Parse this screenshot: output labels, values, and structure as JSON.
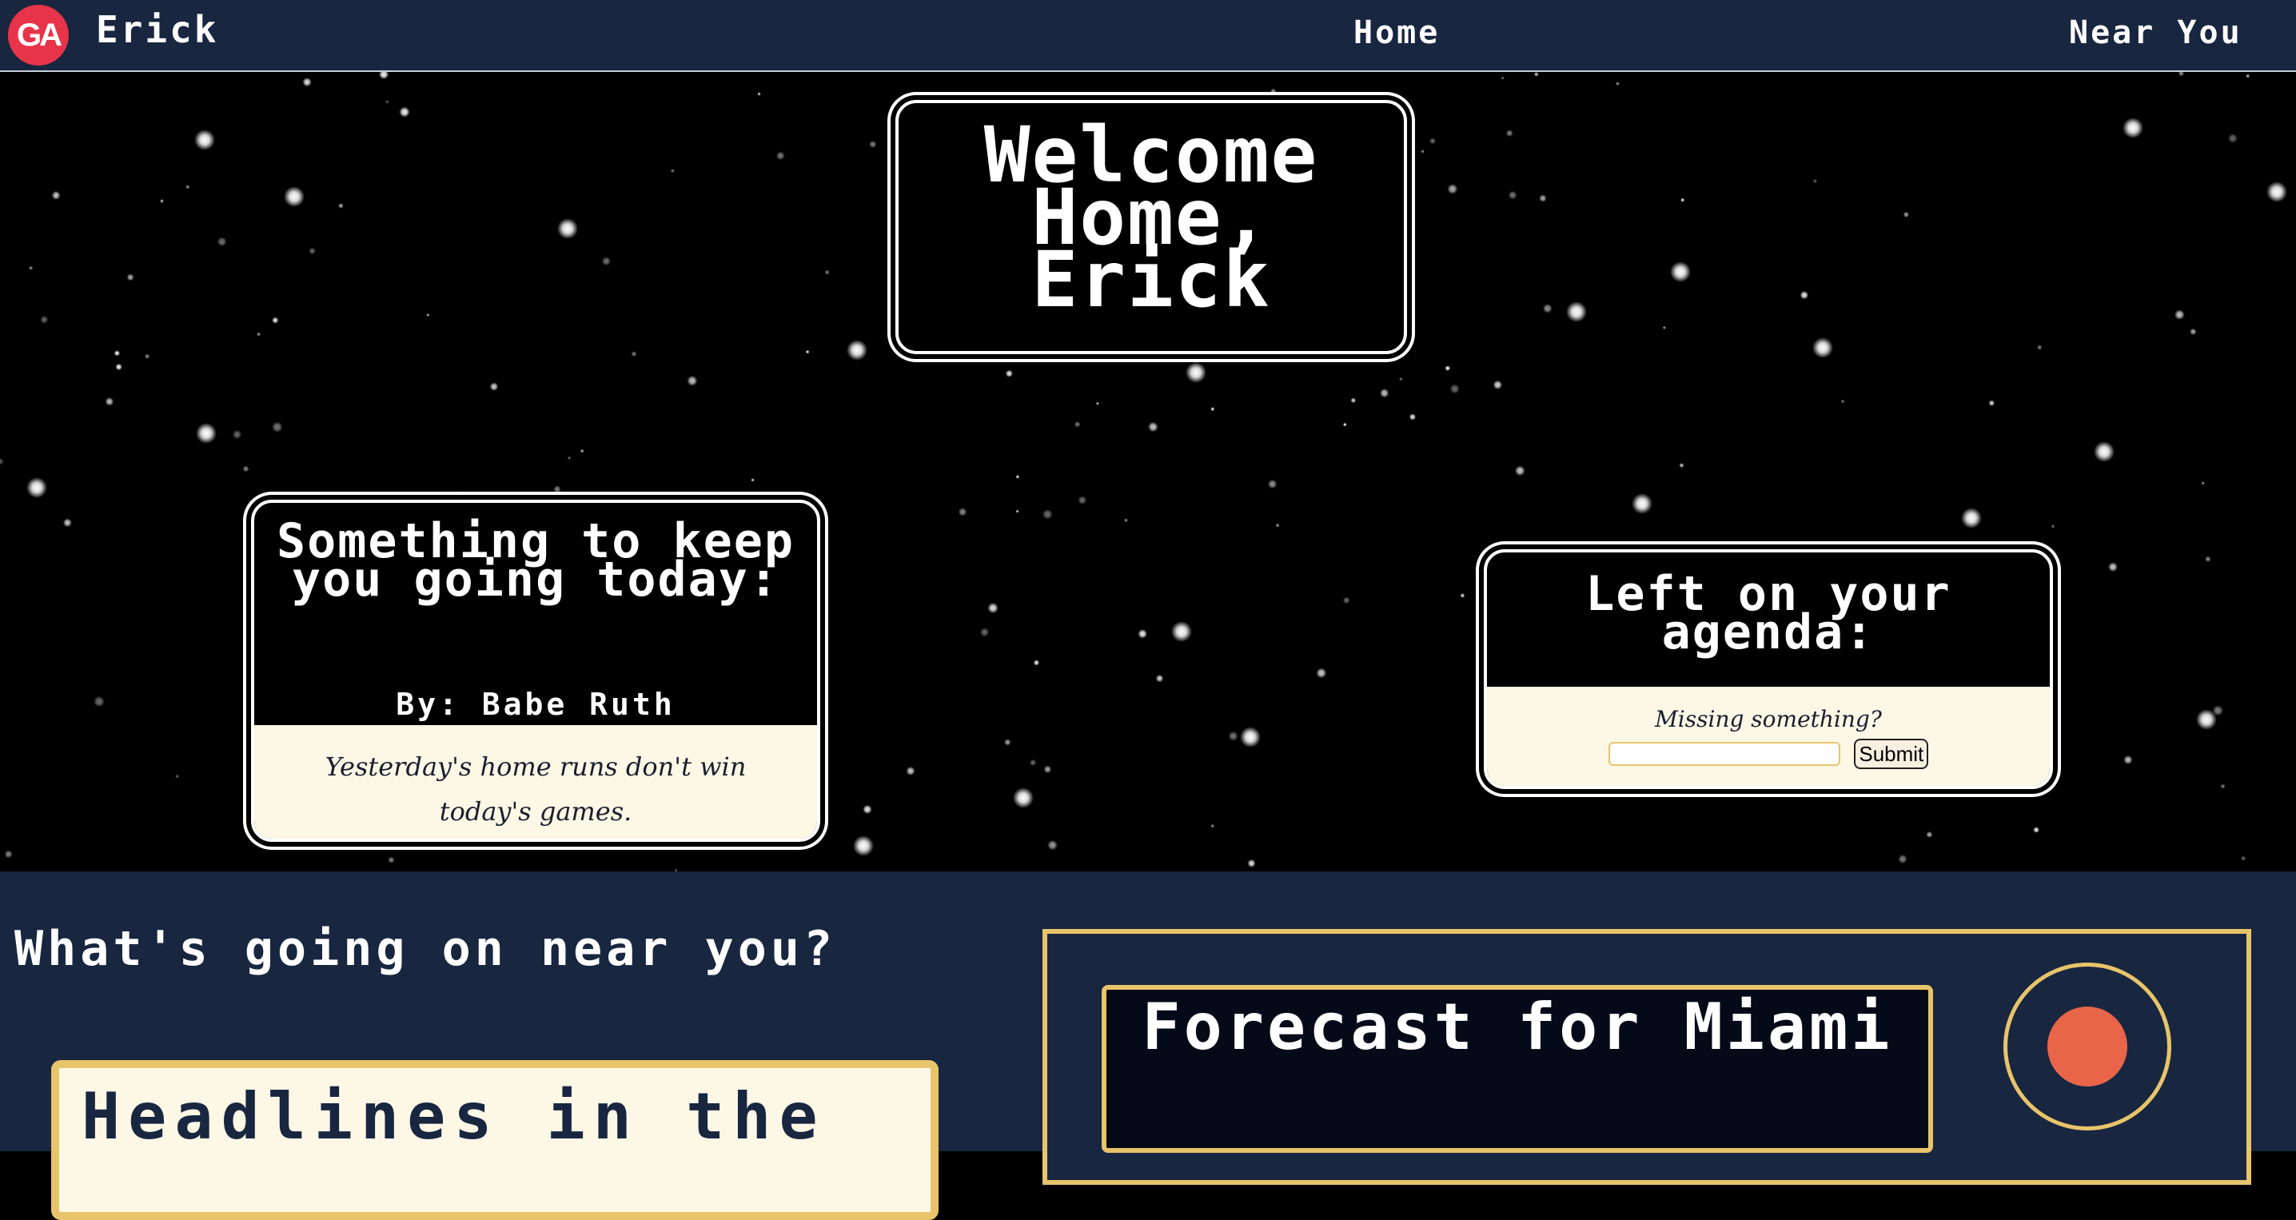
{
  "nav": {
    "logo_text": "GA",
    "user_name": "Erick",
    "home_label": "Home",
    "near_label": "Near You"
  },
  "hero": {
    "welcome_title": "Welcome Home, Erick",
    "quote": {
      "heading": "Something to keep you going today:",
      "author": "By: Babe Ruth",
      "text": "Yesterday's home runs don't win today's games."
    },
    "agenda": {
      "heading": "Left on your agenda:",
      "prompt": "Missing something?",
      "input_value": "",
      "submit_label": "Submit"
    }
  },
  "lower": {
    "near_heading": "What's going on near you?",
    "headlines_title": "Headlines in the",
    "forecast_title": "Forecast for Miami"
  },
  "colors": {
    "navy": "#182640",
    "gold": "#e8c46a",
    "cream": "#fdf7e6",
    "logo_red": "#e8344a",
    "weather_dot": "#e8654a"
  }
}
